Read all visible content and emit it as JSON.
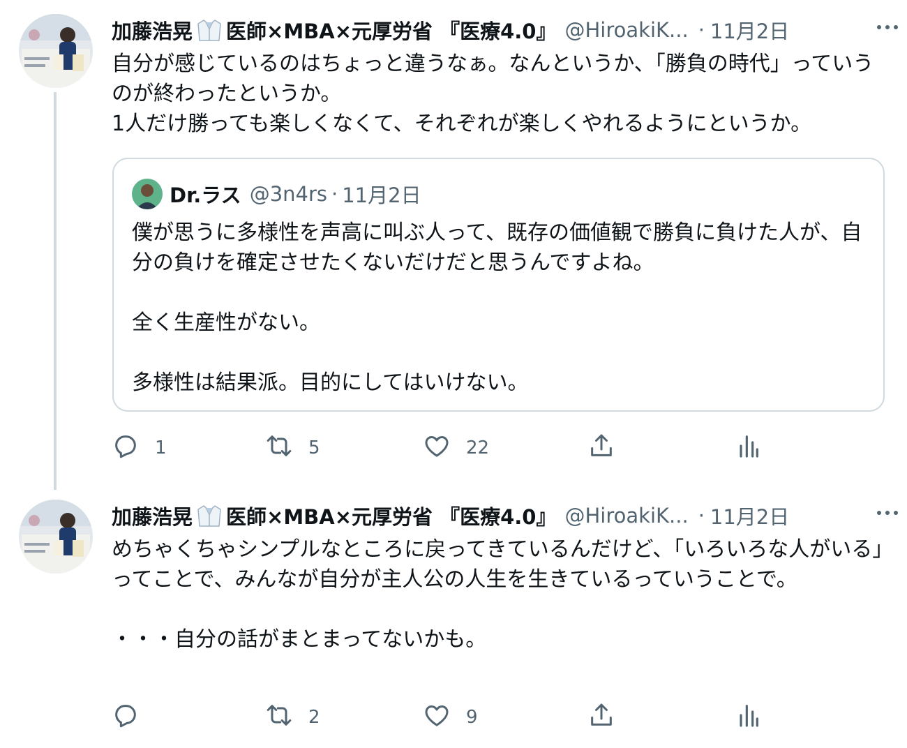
{
  "colors": {
    "text_primary": "#0f1419",
    "text_secondary": "#536471",
    "border": "#cfd9de",
    "thread_line": "#cfd9de"
  },
  "tweets": [
    {
      "author": {
        "name_part1": "加藤浩晃",
        "name_part2": "医師×MBA×元厚労省 『医療4.0』",
        "name_emoji": "lab-coat-icon",
        "handle": "@HiroakiK...",
        "separator": "·",
        "time": "11月2日"
      },
      "text": "自分が感じているのはちょっと違うなぁ。なんというか、「勝負の時代」っていうのが終わったというか。\n1人だけ勝っても楽しくなくて、それぞれが楽しくやれるようにというか。",
      "quote": {
        "name": "Dr.ラス",
        "handle": "@3n4rs",
        "separator": "·",
        "time": "11月2日",
        "text": "僕が思うに多様性を声高に叫ぶ人って、既存の価値観で勝負に負けた人が、自分の負けを確定させたくないだけだと思うんですよね。\n\n全く生産性がない。\n\n多様性は結果派。目的にしてはいけない。"
      },
      "actions": {
        "reply_count": "1",
        "retweet_count": "5",
        "like_count": "22"
      }
    },
    {
      "author": {
        "name_part1": "加藤浩晃",
        "name_part2": "医師×MBA×元厚労省 『医療4.0』",
        "name_emoji": "lab-coat-icon",
        "handle": "@HiroakiK...",
        "separator": "·",
        "time": "11月2日"
      },
      "text": "めちゃくちゃシンプルなところに戻ってきているんだけど、「いろいろな人がいる」ってことで、みんなが自分が主人公の人生を生きているっていうことで。\n\n・・・自分の話がまとまってないかも。",
      "actions": {
        "reply_count": "",
        "retweet_count": "2",
        "like_count": "9"
      }
    }
  ]
}
